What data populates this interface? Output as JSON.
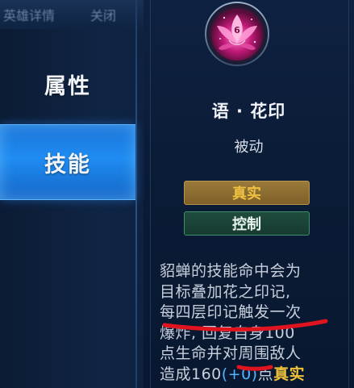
{
  "header": {
    "crumb_left": "英雄详情",
    "crumb_right": "关闭"
  },
  "nav": {
    "items": [
      {
        "label": "属性",
        "selected": false
      },
      {
        "label": "技能",
        "selected": true
      }
    ]
  },
  "skill": {
    "icon": "lotus-seal-icon",
    "icon_badge": "6",
    "name": "语 · 花印",
    "type": "被动",
    "tags": [
      {
        "label": "真实",
        "color": "#f0c040"
      },
      {
        "label": "控制",
        "color": "#e8f2ee"
      }
    ],
    "description": {
      "line1": "貂蝉的技能命中会为",
      "line2": "目标叠加花之印记,",
      "line3": "每四层印记触发一次",
      "line4": "爆炸, 回复自身100",
      "line5": "点生命并对周围敌人",
      "line6_a": "造成160",
      "line6_b": "(+0)",
      "line6_c": "点",
      "line6_d": "真实"
    }
  },
  "colors": {
    "selected_tab": "#1f8cf2",
    "true_damage_text": "#f0c040",
    "control_tag_bg": "#1f4c3e",
    "annotation_red": "#e0141e",
    "scaling_blue": "#4fb6ff"
  }
}
